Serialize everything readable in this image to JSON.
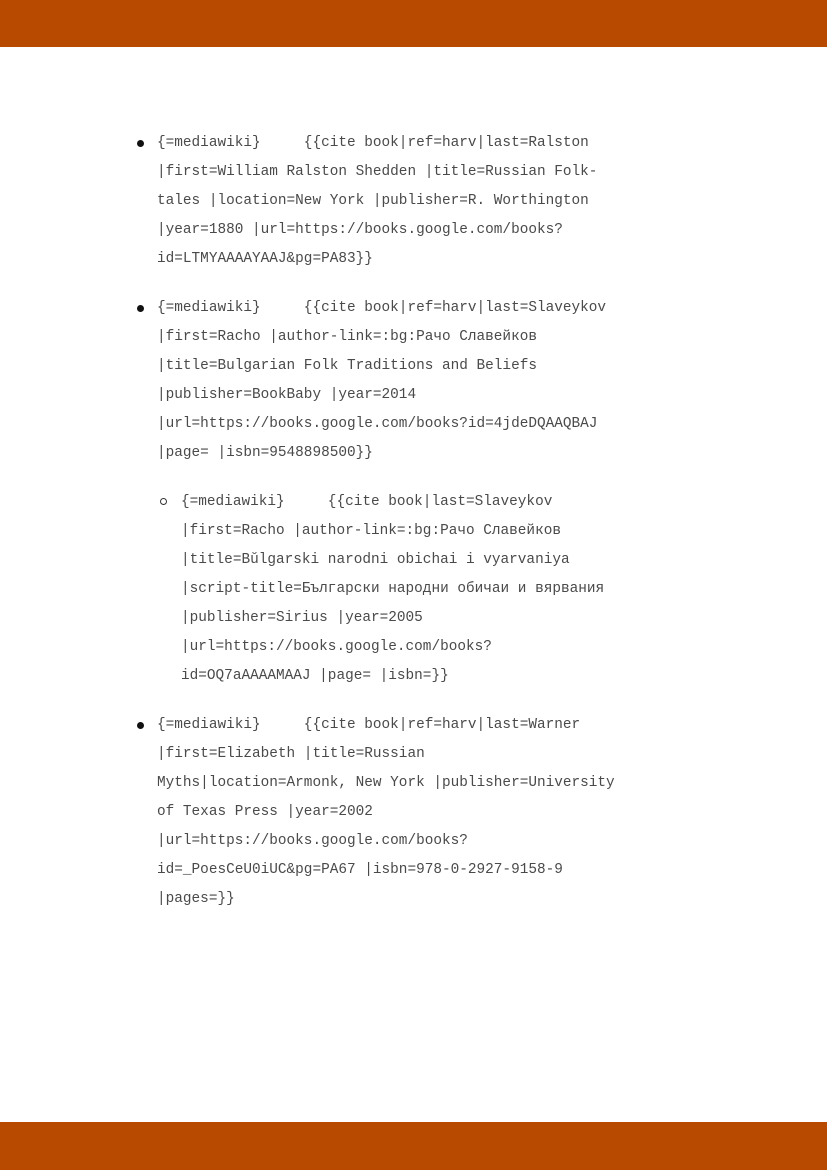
{
  "colors": {
    "accent_bar": "#b84a00",
    "text": "#4a4a4a"
  },
  "entries": [
    {
      "level": 1,
      "lines": [
        "{=mediawiki}     {{cite book|ref=harv|last=Ralston",
        "|first=William Ralston Shedden |title=Russian Folk-",
        "tales |location=New York |publisher=R. Worthington",
        "|year=1880 |url=https://books.google.com/books?",
        "id=LTMYAAAAYAAJ&pg=PA83}}"
      ]
    },
    {
      "level": 1,
      "lines": [
        "{=mediawiki}     {{cite book|ref=harv|last=Slaveykov",
        "|first=Racho |author-link=:bg:Рачо Славейков",
        "|title=Bulgarian Folk Traditions and Beliefs",
        "|publisher=BookBaby |year=2014",
        "|url=https://books.google.com/books?id=4jdeDQAAQBAJ",
        "|page= |isbn=9548898500}}"
      ]
    },
    {
      "level": 2,
      "lines": [
        "{=mediawiki}     {{cite book|last=Slaveykov",
        "|first=Racho |author-link=:bg:Рачо Славейков",
        "|title=Bŭlgarski narodni obichai i vyarvaniya",
        "|script-title=Български народни обичаи и вярвания",
        "|publisher=Sirius |year=2005",
        "|url=https://books.google.com/books?",
        "id=OQ7aAAAAMAAJ |page= |isbn=}}"
      ]
    },
    {
      "level": 1,
      "lines": [
        "{=mediawiki}     {{cite book|ref=harv|last=Warner",
        "|first=Elizabeth |title=Russian",
        "Myths|location=Armonk, New York |publisher=University",
        "of Texas Press |year=2002",
        "|url=https://books.google.com/books?",
        "id=_PoesCeU0iUC&pg=PA67 |isbn=978-0-2927-9158-9",
        "|pages=}}"
      ]
    }
  ]
}
